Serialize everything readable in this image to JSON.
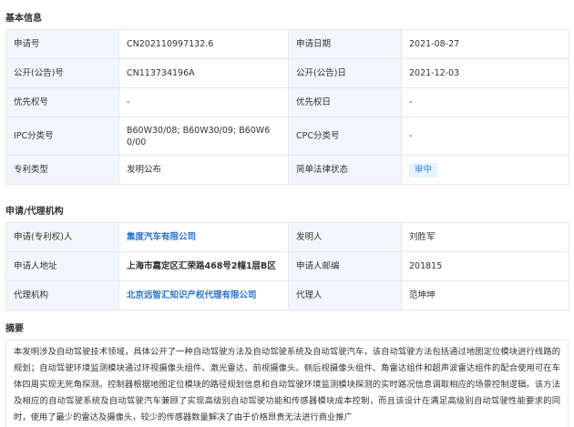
{
  "basic_info": {
    "title": "基本信息",
    "rows": [
      {
        "l1": "申请号",
        "v1": "CN202110997132.6",
        "l2": "申请日期",
        "v2": "2021-08-27"
      },
      {
        "l1": "公开(公告)号",
        "v1": "CN113734196A",
        "l2": "公开(公告)日",
        "v2": "2021-12-03"
      },
      {
        "l1": "优先权号",
        "v1": "-",
        "l2": "优先权日",
        "v2": "-"
      },
      {
        "l1": "IPC分类号",
        "v1a": "B60W30/08; B60W30/09; B60W6",
        "v1b": "0/00",
        "l2": "CPC分类号",
        "v2": "-"
      },
      {
        "l1": "专利类型",
        "v1": "发明公布",
        "l2": "简单法律状态",
        "v2": "审中"
      }
    ]
  },
  "agency": {
    "title": "申请/代理机构",
    "rows": [
      {
        "l1": "申请(专利权)人",
        "v1": "集度汽车有限公司",
        "l2": "发明人",
        "v2": "刘胜军"
      },
      {
        "l1": "申请人地址",
        "v1": "上海市嘉定区汇荣路468号2幢1层B区",
        "l2": "申请人邮编",
        "v2": "201815"
      },
      {
        "l1": "代理机构",
        "v1": "北京远智汇知识产权代理有限公司",
        "l2": "代理人",
        "v2": "范坤坤"
      }
    ]
  },
  "abstract": {
    "title": "摘要",
    "text": "本发明涉及自动驾驶技术领域，具体公开了一种自动驾驶方法及自动驾驶系统及自动驾驶汽车，该自动驾驶方法包括通过地图定位模块进行线路的规划；自动驾驶环境监测模块通过环视摄像头组件、激光雷达、前视摄像头、侧后视摄像头组件、角雷达组件和超声波雷达组件的配合使用可在车体四周实现无死角探测。控制器根据地图定位模块的路径规划信息和自动驾驶环境监测模块探测的实时路况信息调取相应的场景控制逻辑。该方法及相应的自动驾驶系统及自动驾驶汽车兼顾了实现高级别自动驾驶功能和传感器模块成本控制，而且该设计在满足高级别自动驾驶性能要求的同时，使用了最少的雷达及摄像头，较少的传感器数量解决了由于价格昂贵无法进行商业推广"
  }
}
